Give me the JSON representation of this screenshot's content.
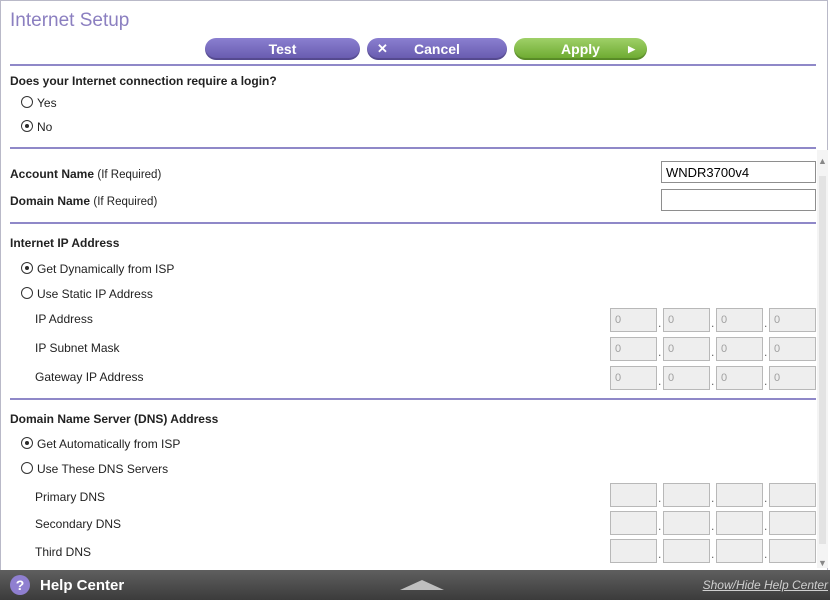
{
  "page": {
    "title": "Internet Setup"
  },
  "toolbar": {
    "test_label": "Test",
    "cancel_label": "Cancel",
    "apply_label": "Apply"
  },
  "login": {
    "question": "Does your Internet connection require a login?",
    "options": [
      {
        "label": "Yes",
        "selected": false
      },
      {
        "label": "No",
        "selected": true
      }
    ]
  },
  "account": {
    "account_name_label": "Account Name",
    "domain_name_label": "Domain Name",
    "if_required": "(If Required)",
    "account_name_value": "WNDR3700v4",
    "domain_name_value": ""
  },
  "ip": {
    "heading": "Internet IP Address",
    "options": [
      {
        "label": "Get Dynamically from ISP",
        "selected": true
      },
      {
        "label": "Use Static IP Address",
        "selected": false
      }
    ],
    "fields": [
      {
        "label": "IP Address",
        "octets": [
          "0",
          "0",
          "0",
          "0"
        ]
      },
      {
        "label": "IP Subnet Mask",
        "octets": [
          "0",
          "0",
          "0",
          "0"
        ]
      },
      {
        "label": "Gateway IP Address",
        "octets": [
          "0",
          "0",
          "0",
          "0"
        ]
      }
    ]
  },
  "dns": {
    "heading": "Domain Name Server (DNS) Address",
    "options": [
      {
        "label": "Get Automatically from ISP",
        "selected": true
      },
      {
        "label": "Use These DNS Servers",
        "selected": false
      }
    ],
    "fields": [
      {
        "label": "Primary DNS",
        "octets": [
          "",
          "",
          "",
          ""
        ]
      },
      {
        "label": "Secondary DNS",
        "octets": [
          "",
          "",
          "",
          ""
        ]
      },
      {
        "label": "Third DNS",
        "octets": [
          "",
          "",
          "",
          ""
        ]
      }
    ]
  },
  "help": {
    "title": "Help Center",
    "toggle_link": "Show/Hide Help Center"
  },
  "colors": {
    "accent": "#8b7fc0",
    "button_purple": "#6f62b8",
    "button_green": "#7ab63d",
    "divider": "#8f88c8"
  }
}
